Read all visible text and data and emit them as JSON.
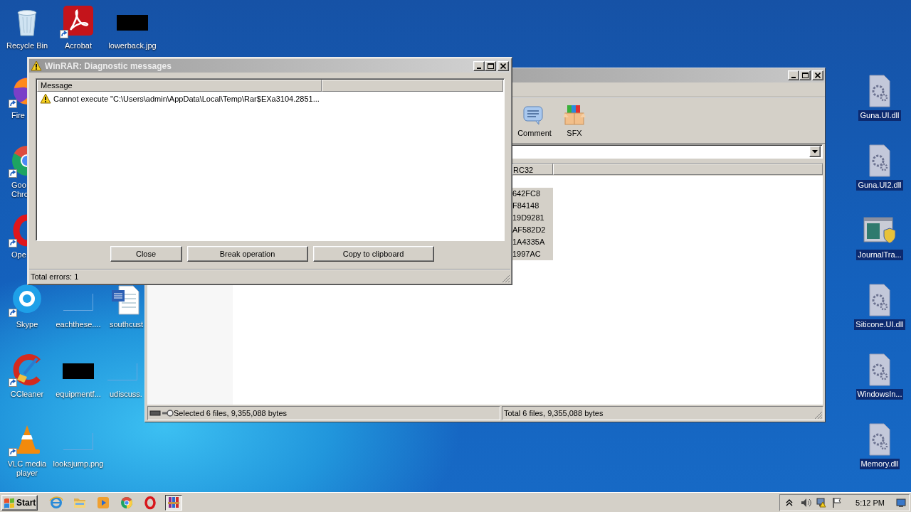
{
  "desktop": {
    "columns": [
      [
        {
          "label": "Recycle Bin",
          "kind": "recycle",
          "shortcut": false,
          "selected": false,
          "cut": false
        },
        {
          "label": "Fire",
          "kind": "firefox",
          "shortcut": true,
          "selected": false,
          "cut": true
        },
        {
          "label": "Goo Chro",
          "kind": "chrome",
          "shortcut": true,
          "selected": false,
          "cut": true
        },
        {
          "label": "Ope",
          "kind": "opera",
          "shortcut": true,
          "selected": false,
          "cut": true
        },
        {
          "label": "Skype",
          "kind": "skype",
          "shortcut": true,
          "selected": false,
          "cut": false
        },
        {
          "label": "CCleaner",
          "kind": "ccleaner",
          "shortcut": true,
          "selected": false,
          "cut": false
        },
        {
          "label": "VLC media player",
          "kind": "vlc",
          "shortcut": true,
          "selected": false,
          "cut": false
        }
      ],
      [
        {
          "label": "Acrobat",
          "kind": "pdf",
          "shortcut": true,
          "selected": false,
          "cut": false
        },
        {
          "label": "eachthese....",
          "kind": "image-blank",
          "shortcut": false,
          "selected": false,
          "cut": false
        },
        {
          "label": "equipmentf...",
          "kind": "image-dark",
          "shortcut": false,
          "selected": false,
          "cut": false
        },
        {
          "label": "looksjump.png",
          "kind": "image-blank",
          "shortcut": false,
          "selected": false,
          "cut": false
        }
      ],
      [
        {
          "label": "lowerback.jpg",
          "kind": "image-dark",
          "shortcut": false,
          "selected": false,
          "cut": false
        },
        {
          "label": "southcust",
          "kind": "word",
          "shortcut": false,
          "selected": false,
          "cut": true
        },
        {
          "label": "udiscuss.",
          "kind": "image-blank",
          "shortcut": false,
          "selected": false,
          "cut": true
        }
      ]
    ],
    "right_column": [
      {
        "label": "Guna.UI.dll",
        "kind": "dll",
        "shortcut": false,
        "selected": true,
        "cut": false
      },
      {
        "label": "Guna.UI2.dll",
        "kind": "dll",
        "shortcut": false,
        "selected": true,
        "cut": false
      },
      {
        "label": "JournalTra...",
        "kind": "journal",
        "shortcut": false,
        "selected": true,
        "cut": false
      },
      {
        "label": "Siticone.UI.dll",
        "kind": "dll",
        "shortcut": false,
        "selected": true,
        "cut": false
      },
      {
        "label": "WindowsIn...",
        "kind": "dll",
        "shortcut": false,
        "selected": true,
        "cut": false
      },
      {
        "label": "Memory.dll",
        "kind": "dll",
        "shortcut": false,
        "selected": true,
        "cut": false
      }
    ]
  },
  "archive_window": {
    "toolbar": [
      {
        "label": "Comment",
        "kind": "comment"
      },
      {
        "label": "SFX",
        "kind": "sfx"
      }
    ],
    "columns": [
      "RC32"
    ],
    "rows": [
      {
        "crc": "642FC8",
        "selected": true
      },
      {
        "crc": "F84148",
        "selected": true
      },
      {
        "crc": "19D9281",
        "selected": true
      },
      {
        "crc": "AF582D2",
        "selected": true
      },
      {
        "crc": "1A4335A",
        "selected": true
      },
      {
        "crc": "1997AC",
        "selected": true
      }
    ],
    "status_left": "Selected 6 files, 9,355,088 bytes",
    "status_right": "Total 6 files, 9,355,088 bytes"
  },
  "dialog": {
    "title": "WinRAR: Diagnostic messages",
    "columns": [
      "Message"
    ],
    "messages": [
      {
        "kind": "warning",
        "text": "Cannot execute \"C:\\Users\\admin\\AppData\\Local\\Temp\\Rar$EXa3104.2851..."
      }
    ],
    "buttons": [
      "Close",
      "Break operation",
      "Copy to clipboard"
    ],
    "status": "Total errors: 1"
  },
  "taskbar": {
    "start": "Start",
    "apps": [
      {
        "kind": "ie",
        "active": false
      },
      {
        "kind": "folder",
        "active": false
      },
      {
        "kind": "media",
        "active": false
      },
      {
        "kind": "chrome",
        "active": false
      },
      {
        "kind": "opera",
        "active": false
      },
      {
        "kind": "winrar",
        "active": true
      }
    ],
    "tray": [
      {
        "kind": "expand"
      },
      {
        "kind": "speaker"
      },
      {
        "kind": "network"
      },
      {
        "kind": "flag"
      }
    ],
    "clock": "5:12 PM"
  }
}
